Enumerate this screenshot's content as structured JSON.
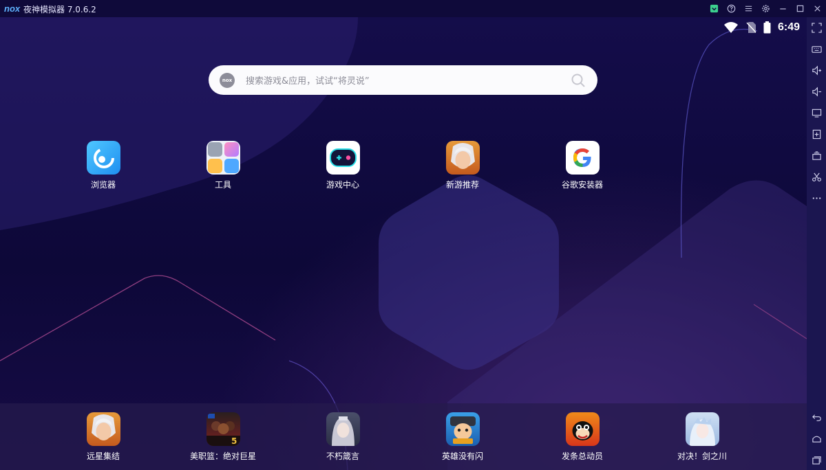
{
  "window": {
    "logo": "nox",
    "title": "夜神模拟器 7.0.6.2"
  },
  "status_bar": {
    "time": "6:49"
  },
  "search": {
    "badge": "nox",
    "placeholder": "搜索游戏&应用，试试“将灵说”"
  },
  "apps": [
    {
      "label": "浏览器",
      "icon": "browser-icon"
    },
    {
      "label": "工具",
      "icon": "tools-folder-icon"
    },
    {
      "label": "游戏中心",
      "icon": "game-center-icon"
    },
    {
      "label": "新游推荐",
      "icon": "new-games-icon"
    },
    {
      "label": "谷歌安装器",
      "icon": "google-installer-icon"
    }
  ],
  "dock": [
    {
      "label": "远星集结",
      "icon": "game-icon"
    },
    {
      "label": "美职篮：绝对巨星",
      "icon": "game-icon"
    },
    {
      "label": "不朽箴言",
      "icon": "game-icon"
    },
    {
      "label": "英雄没有闪",
      "icon": "game-icon"
    },
    {
      "label": "发条总动员",
      "icon": "game-icon"
    },
    {
      "label": "对决！剑之川",
      "icon": "game-icon"
    }
  ],
  "colors": {
    "background": "#0c0838",
    "titlebar": "#0f0a3a",
    "sidebar": "#1b1650",
    "accent_green": "#3ccf8e"
  }
}
